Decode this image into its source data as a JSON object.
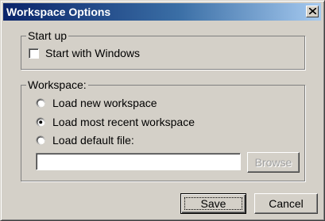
{
  "window": {
    "title": "Workspace Options",
    "close_glyph": "×"
  },
  "startup": {
    "legend": "Start up",
    "start_with_windows": {
      "label": "Start with Windows",
      "checked": false
    }
  },
  "workspace": {
    "legend": "Workspace:",
    "options": [
      {
        "label": "Load new workspace",
        "selected": false
      },
      {
        "label": "Load most recent workspace",
        "selected": true
      },
      {
        "label": "Load default file:",
        "selected": false
      }
    ],
    "default_file_value": "",
    "browse_label": "Browse",
    "browse_enabled": false
  },
  "buttons": {
    "save_label": "Save",
    "cancel_label": "Cancel"
  },
  "colors": {
    "face": "#d4d0c8",
    "title_start": "#0a246a",
    "title_end": "#a6caf0"
  }
}
